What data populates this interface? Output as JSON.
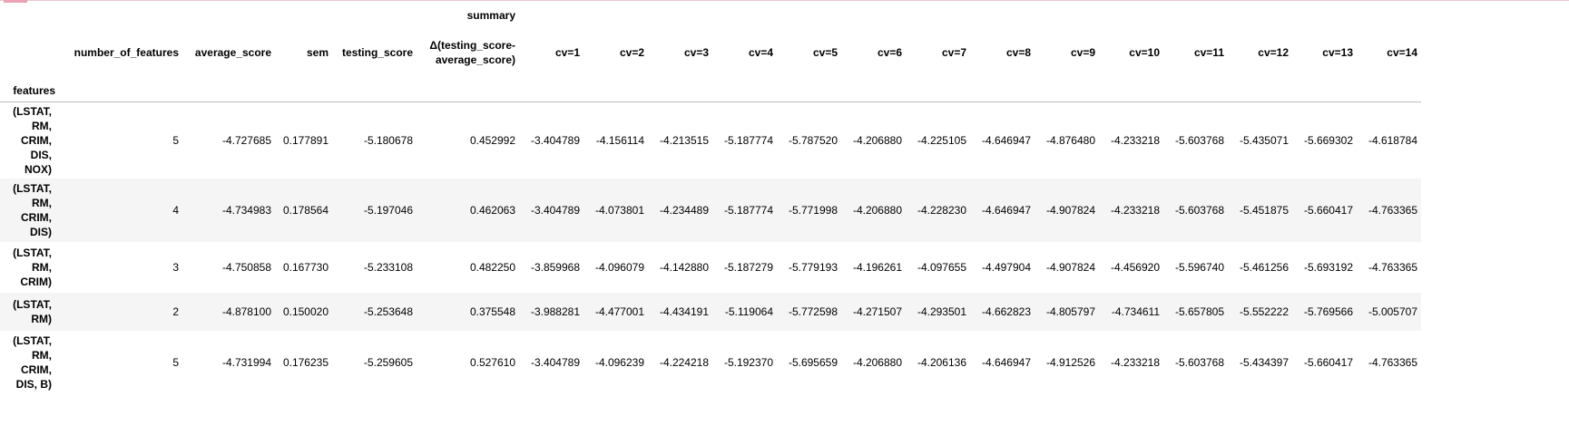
{
  "table": {
    "group_header": "summary",
    "index_name": "features",
    "columns": [
      "number_of_features",
      "average_score",
      "sem",
      "testing_score",
      "Δ(testing_score-average_score)",
      "cv=1",
      "cv=2",
      "cv=3",
      "cv=4",
      "cv=5",
      "cv=6",
      "cv=7",
      "cv=8",
      "cv=9",
      "cv=10",
      "cv=11",
      "cv=12",
      "cv=13",
      "cv=14"
    ],
    "rows": [
      {
        "index": "(LSTAT, RM, CRIM, DIS, NOX)",
        "values": [
          "5",
          "-4.727685",
          "0.177891",
          "-5.180678",
          "0.452992",
          "-3.404789",
          "-4.156114",
          "-4.213515",
          "-5.187774",
          "-5.787520",
          "-4.206880",
          "-4.225105",
          "-4.646947",
          "-4.876480",
          "-4.233218",
          "-5.603768",
          "-5.435071",
          "-5.669302",
          "-4.618784"
        ]
      },
      {
        "index": "(LSTAT, RM, CRIM, DIS)",
        "values": [
          "4",
          "-4.734983",
          "0.178564",
          "-5.197046",
          "0.462063",
          "-3.404789",
          "-4.073801",
          "-4.234489",
          "-5.187774",
          "-5.771998",
          "-4.206880",
          "-4.228230",
          "-4.646947",
          "-4.907824",
          "-4.233218",
          "-5.603768",
          "-5.451875",
          "-5.660417",
          "-4.763365"
        ]
      },
      {
        "index": "(LSTAT, RM, CRIM)",
        "values": [
          "3",
          "-4.750858",
          "0.167730",
          "-5.233108",
          "0.482250",
          "-3.859968",
          "-4.096079",
          "-4.142880",
          "-5.187279",
          "-5.779193",
          "-4.196261",
          "-4.097655",
          "-4.497904",
          "-4.907824",
          "-4.456920",
          "-5.596740",
          "-5.461256",
          "-5.693192",
          "-4.763365"
        ]
      },
      {
        "index": "(LSTAT, RM)",
        "values": [
          "2",
          "-4.878100",
          "0.150020",
          "-5.253648",
          "0.375548",
          "-3.988281",
          "-4.477001",
          "-4.434191",
          "-5.119064",
          "-5.772598",
          "-4.271507",
          "-4.293501",
          "-4.662823",
          "-4.805797",
          "-4.734611",
          "-5.657805",
          "-5.552222",
          "-5.769566",
          "-5.005707"
        ]
      },
      {
        "index": "(LSTAT, RM, CRIM, DIS, B)",
        "values": [
          "5",
          "-4.731994",
          "0.176235",
          "-5.259605",
          "0.527610",
          "-3.404789",
          "-4.096239",
          "-4.224218",
          "-5.192370",
          "-5.695659",
          "-4.206880",
          "-4.206136",
          "-4.646947",
          "-4.912526",
          "-4.233218",
          "-5.603768",
          "-5.434397",
          "-5.660417",
          "-4.763365"
        ]
      }
    ]
  }
}
